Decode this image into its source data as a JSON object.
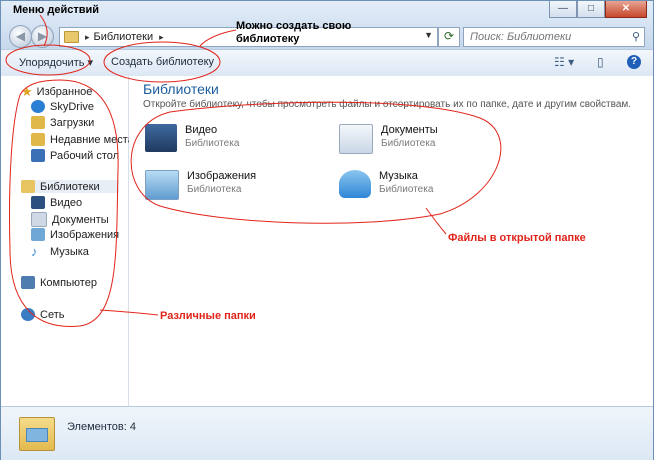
{
  "window": {
    "caption_buttons": {
      "minimize": "—",
      "maximize": "□",
      "close": "✕"
    }
  },
  "address_bar": {
    "crumb_separator": "▸",
    "crumb": "Библиотеки",
    "back_icon": "back-arrow-icon",
    "forward_icon": "forward-arrow-icon"
  },
  "search": {
    "placeholder": "Поиск: Библиотеки"
  },
  "toolbar": {
    "organize_label": "Упорядочить ▾",
    "create_library_label": "Создать библиотеку"
  },
  "nav": {
    "favorites": {
      "label": "Избранное",
      "items": [
        {
          "label": "SkyDrive",
          "icon": "skydrive-icon",
          "color": "#2a7fd4"
        },
        {
          "label": "Загрузки",
          "icon": "downloads-icon",
          "color": "#e0b84a"
        },
        {
          "label": "Недавние места",
          "icon": "recent-places-icon",
          "color": "#e0b84a"
        },
        {
          "label": "Рабочий стол",
          "icon": "desktop-icon",
          "color": "#3b6fb6"
        }
      ]
    },
    "libraries": {
      "label": "Библиотеки",
      "items": [
        {
          "label": "Видео",
          "icon": "video-icon",
          "color": "#2b4f7e"
        },
        {
          "label": "Документы",
          "icon": "documents-icon",
          "color": "#cfd9e6"
        },
        {
          "label": "Изображения",
          "icon": "pictures-icon",
          "color": "#6fa7d6"
        },
        {
          "label": "Музыка",
          "icon": "music-icon",
          "color": "#3a8fd8"
        }
      ]
    },
    "computer": {
      "label": "Компьютер"
    },
    "network": {
      "label": "Сеть"
    }
  },
  "content": {
    "title": "Библиотеки",
    "subtitle": "Откройте библиотеку, чтобы просмотреть файлы и отсортировать их по папке, дате и другим свойствам.",
    "libraries": [
      {
        "name": "Видео",
        "type": "Библиотека",
        "icon": "video-library-icon",
        "color": "#2b4f7e"
      },
      {
        "name": "Документы",
        "type": "Библиотека",
        "icon": "documents-library-icon",
        "color": "#c9d6e6"
      },
      {
        "name": "Изображения",
        "type": "Библиотека",
        "icon": "pictures-library-icon",
        "color": "#7fb5de"
      },
      {
        "name": "Музыка",
        "type": "Библиотека",
        "icon": "music-library-icon",
        "color": "#2f86d6"
      }
    ]
  },
  "status": {
    "items_count": "Элементов: 4"
  },
  "annotations": {
    "actions_menu": "Меню действий",
    "create_library": "Можно создать свою\nбиблиотеку",
    "files_in_folder": "Файлы в открытой папке",
    "various_folders": "Различные папки"
  },
  "colors": {
    "annotation_red": "#e0241b",
    "library_title": "#1e5e9e"
  }
}
